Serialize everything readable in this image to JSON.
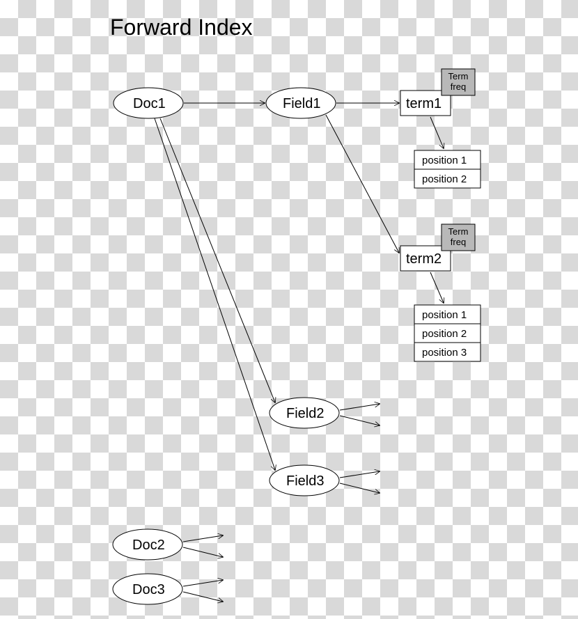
{
  "title": "Forward Index",
  "docs": {
    "doc1": "Doc1",
    "doc2": "Doc2",
    "doc3": "Doc3"
  },
  "fields": {
    "field1": "Field1",
    "field2": "Field2",
    "field3": "Field3"
  },
  "terms": {
    "term1": {
      "label": "term1",
      "freq_label": "Term\nfreq",
      "positions": [
        "position 1",
        "position 2"
      ]
    },
    "term2": {
      "label": "term2",
      "freq_label": "Term\nfreq",
      "positions": [
        "position 1",
        "position 2",
        "position 3"
      ]
    }
  }
}
